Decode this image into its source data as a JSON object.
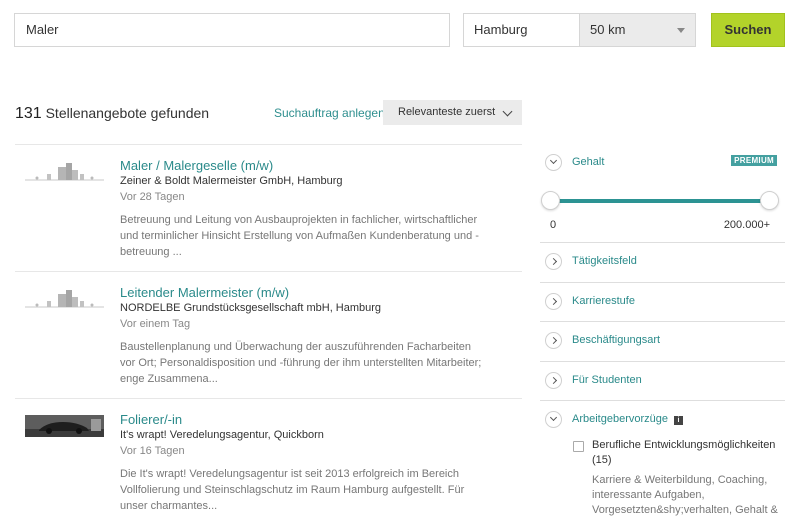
{
  "search": {
    "keyword": "Maler",
    "location": "Hamburg",
    "radius": "50 km",
    "button_label": "Suchen"
  },
  "results": {
    "count": "131",
    "count_label": "Stellenangebote gefunden",
    "save_search_label": "Suchauftrag anlegen",
    "sort_label": "Relevanteste zuerst"
  },
  "jobs": [
    {
      "title": "Maler / Malergeselle (m/w)",
      "company": "Zeiner & Boldt Malermeister GmbH, Hamburg",
      "age": "Vor 28 Tagen",
      "description": "Betreuung und Leitung von Ausbauprojekten in fachlicher, wirtschaftlicher und terminlicher Hinsicht Erstellung von Aufmaßen Kundenberatung und -betreuung ..."
    },
    {
      "title": "Leitender Malermeister (m/w)",
      "company": "NORDELBE Grundstücksgesellschaft mbH, Hamburg",
      "age": "Vor einem Tag",
      "description": "Baustellenplanung und Überwachung der auszuführenden Facharbeiten vor Ort; Personaldisposition und -führung der ihm unterstellten Mitarbeiter; enge Zusammena..."
    },
    {
      "title": "Folierer/-in",
      "company": "It's wrapt! Veredelungsagentur, Quickborn",
      "age": "Vor 16 Tagen",
      "description": "Die It's wrapt! Veredelungsagentur ist seit 2013 erfolgreich im Bereich Vollfolierung und Steinschlagschutz im Raum Hamburg aufgestellt. Für unser charmantes..."
    }
  ],
  "filters": {
    "salary": {
      "label": "Gehalt",
      "badge": "PREMIUM",
      "min_label": "0",
      "max_label": "200.000+",
      "range_fraction": [
        0,
        1
      ]
    },
    "activity_field": "Tätigkeitsfeld",
    "career_level": "Karrierestufe",
    "employment_type": "Beschäftigungsart",
    "for_students": "Für Studenten",
    "employer_benefits": {
      "label": "Arbeitgebervorzüge",
      "info": "i",
      "option_label": "Berufliche Entwicklungsmöglichkeiten (15)",
      "option_desc": "Karriere & Weiterbildung, Coaching, interessante Aufgaben, Vorgesetzten&shy;verhalten, Gehalt &"
    }
  },
  "colors": {
    "accent": "#2a8a8a",
    "search_button": "#b3d32a",
    "premium": "#44a0a0"
  }
}
